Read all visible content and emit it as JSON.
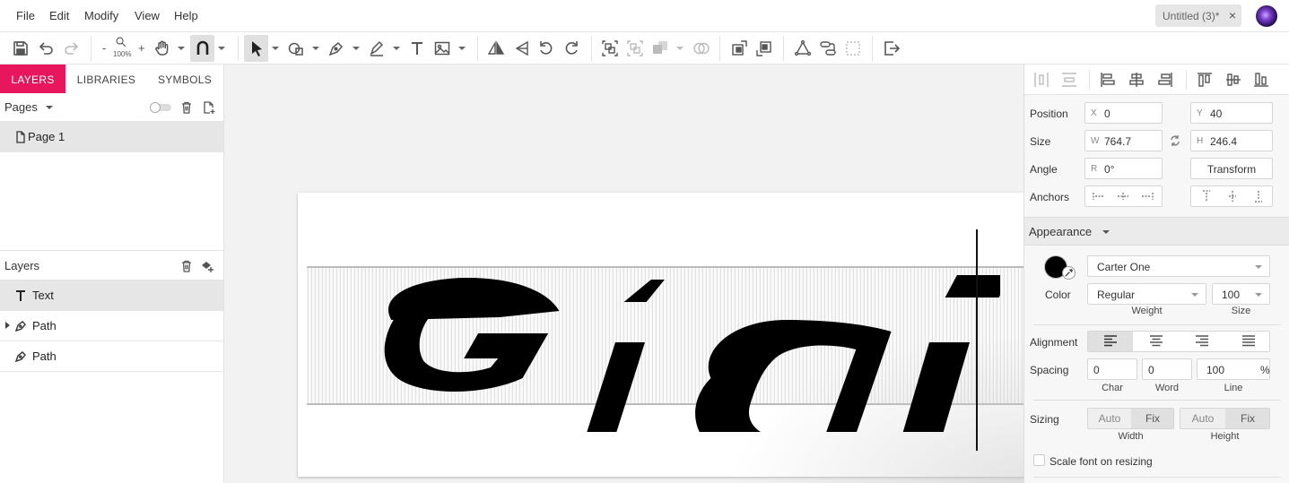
{
  "menubar": {
    "items": [
      "File",
      "Edit",
      "Modify",
      "View",
      "Help"
    ],
    "doc_tab": "Untitled (3)*",
    "doc_tab_close": "×"
  },
  "toolbar": {
    "zoom_minus": "-",
    "zoom_plus": "+",
    "zoom_level": "100%"
  },
  "left_panel": {
    "tabs": [
      "LAYERS",
      "LIBRARIES",
      "SYMBOLS"
    ],
    "active_tab": "LAYERS",
    "pages_label": "Pages",
    "pages": [
      "Page 1"
    ],
    "layers_label": "Layers",
    "layers": [
      {
        "name": "Text",
        "icon": "text-icon",
        "selected": true
      },
      {
        "name": "Path",
        "icon": "pen-icon",
        "expandable": true
      },
      {
        "name": "Path",
        "icon": "pen-icon"
      }
    ]
  },
  "canvas": {
    "text_content": "Gigi"
  },
  "properties": {
    "position_label": "Position",
    "x_prefix": "X",
    "x": "0",
    "y_prefix": "Y",
    "y": "40",
    "size_label": "Size",
    "w_prefix": "W",
    "w": "764.7",
    "h_prefix": "H",
    "h": "246.4",
    "angle_label": "Angle",
    "r_prefix": "R",
    "angle": "0°",
    "transform_button": "Transform",
    "anchors_label": "Anchors",
    "appearance_label": "Appearance",
    "color_label": "Color",
    "fill_color": "#000000",
    "font_family": "Carter One",
    "font_weight": "Regular",
    "font_size": "100",
    "weight_label": "Weight",
    "size_sub_label": "Size",
    "alignment_label": "Alignment",
    "alignment_active": "left",
    "spacing_label": "Spacing",
    "char_spacing": "0",
    "word_spacing": "0",
    "line_spacing": "100",
    "percent": "%",
    "char_label": "Char",
    "word_label": "Word",
    "line_label": "Line",
    "sizing_label": "Sizing",
    "auto_label": "Auto",
    "fix_label": "Fix",
    "width_label": "Width",
    "height_label": "Height",
    "scale_font_label": "Scale font on resizing",
    "scale_font_checked": false
  },
  "colors": {
    "accent": "#e8175d"
  }
}
